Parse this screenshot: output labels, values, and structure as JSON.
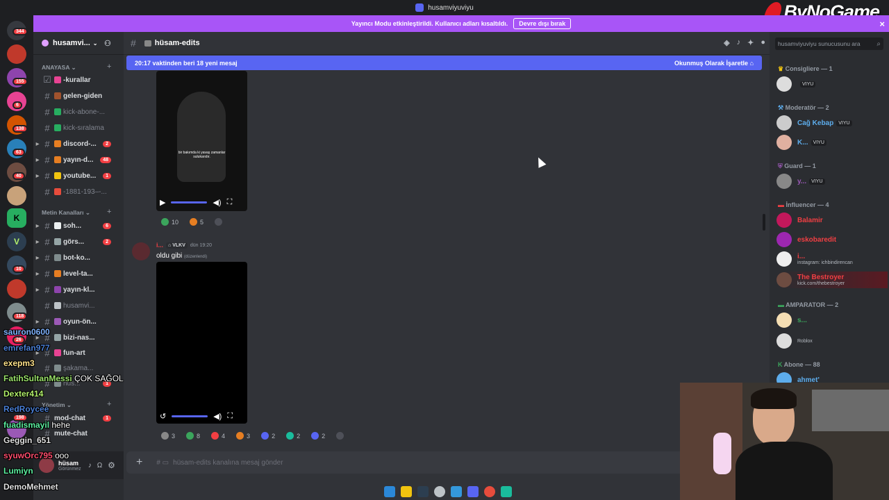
{
  "window": {
    "title": "husamviyuviyu"
  },
  "brand": {
    "text": "ByNoGame"
  },
  "banner": {
    "text": "Yayıncı Modu etkinleştirildi. Kullanıcı adları kısaltıldı.",
    "button": "Devre dışı bırak"
  },
  "guild_badges": [
    "344",
    "155",
    "6",
    "138",
    "63",
    "40",
    "10",
    "118",
    "26",
    "198"
  ],
  "server": {
    "name": "husamvi...",
    "chevron": "v"
  },
  "categories": {
    "anayasa": "ANAYASA",
    "metin": "Metin Kanalları",
    "yonetim": "Yönetim"
  },
  "channels": [
    {
      "name": "-kurallar",
      "badge": ""
    },
    {
      "name": "gelen-giden",
      "badge": ""
    },
    {
      "name": "kick-abone-...",
      "badge": ""
    },
    {
      "name": "kick-sıralama",
      "badge": ""
    },
    {
      "name": "discord-...",
      "badge": "2"
    },
    {
      "name": "yayın-d...",
      "badge": "48"
    },
    {
      "name": "youtube...",
      "badge": "1"
    },
    {
      "name": "-1881-193‒-...",
      "badge": ""
    },
    {
      "name": "soh...",
      "badge": "6"
    },
    {
      "name": "görs...",
      "badge": "2"
    },
    {
      "name": "bot-ko...",
      "badge": ""
    },
    {
      "name": "level-ta...",
      "badge": ""
    },
    {
      "name": "yayın-kl...",
      "badge": ""
    },
    {
      "name": "husamvi...",
      "badge": ""
    },
    {
      "name": "oyun-ön...",
      "badge": ""
    },
    {
      "name": "bizi-nas...",
      "badge": ""
    },
    {
      "name": "fun-art",
      "badge": ""
    },
    {
      "name": "şakama...",
      "badge": ""
    },
    {
      "name": "hüs...",
      "badge": "1"
    },
    {
      "name": "mod-chat",
      "badge": "1"
    },
    {
      "name": "mute-chat",
      "badge": ""
    }
  ],
  "user": {
    "name": "hüsam",
    "status": "Görünmez"
  },
  "chat": {
    "channel": "hüsam-edits",
    "new_messages": "20:17 vaktinden beri 18 yeni mesaj",
    "mark_read": "Okunmuş Olarak İşaretle",
    "video_caption": "bir bakımda ki yavaş zamanlar sulukarıdır.",
    "reactions1": [
      {
        "count": "10",
        "color": "#3ba55c"
      },
      {
        "count": "5",
        "color": "#e67e22"
      }
    ],
    "message": {
      "author": "i...",
      "tag": "VLKV",
      "time": "dün 19:20",
      "text": "oldu gibi",
      "edited": "(düzenlendi)"
    },
    "reactions2": [
      {
        "count": "3",
        "color": "#888"
      },
      {
        "count": "8",
        "color": "#3ba55c"
      },
      {
        "count": "4",
        "color": "#f23f43"
      },
      {
        "count": "3",
        "color": "#e67e22"
      },
      {
        "count": "2",
        "color": "#5865f2"
      },
      {
        "count": "2",
        "color": "#1abc9c"
      },
      {
        "count": "2",
        "color": "#5865f2"
      }
    ],
    "input_placeholder": "hüsam-edits kanalına mesaj gönder"
  },
  "members": {
    "search_placeholder": "husamviyuviyu sunucusunu ara",
    "roles": [
      {
        "title": "Consigliere — 1"
      },
      {
        "title": "Moderatör — 2"
      },
      {
        "title": "Guard — 1"
      },
      {
        "title": "İnfluencer — 4"
      },
      {
        "title": "AMPARATOR — 2"
      },
      {
        "title": "Abone — 88"
      }
    ],
    "list": [
      {
        "name": "",
        "tag": "VIYU",
        "color": "#dbdee1",
        "sub": ""
      },
      {
        "name": "Cağ Kebap",
        "tag": "VIYU",
        "color": "#5dadec",
        "sub": ""
      },
      {
        "name": "K...",
        "tag": "VIYU",
        "color": "#5dadec",
        "sub": ""
      },
      {
        "name": "y...",
        "tag": "VIYU",
        "color": "#9b59b6",
        "sub": ""
      },
      {
        "name": "Balamir",
        "tag": "",
        "color": "#f23f43",
        "sub": ""
      },
      {
        "name": "eskobaredit",
        "tag": "",
        "color": "#f23f43",
        "sub": ""
      },
      {
        "name": "i...",
        "tag": "",
        "color": "#f23f43",
        "sub": "instagram: ichbindirencan"
      },
      {
        "name": "The Bestroyer",
        "tag": "",
        "color": "#f23f43",
        "sub": "kick.com/thebestroyer"
      },
      {
        "name": "s...",
        "tag": "",
        "color": "#3ba55c",
        "sub": ""
      },
      {
        "name": "",
        "tag": "",
        "color": "#3ba55c",
        "sub": "Roblox"
      },
      {
        "name": "ahmet'",
        "tag": "",
        "color": "#5dadec",
        "sub": ""
      }
    ]
  },
  "overlay_chat": [
    {
      "user": "sauron0600",
      "color": "#7fb3ff",
      "msg": ""
    },
    {
      "user": "emrefan977",
      "color": "#4a7fd6",
      "msg": ""
    },
    {
      "user": "exepm3",
      "color": "#ffe28a",
      "msg": ""
    },
    {
      "user": "FatihSultanMessi",
      "color": "#9be36b",
      "msg": "ÇOK SAĞOL"
    },
    {
      "user": "Dexter414",
      "color": "#b2f06b",
      "msg": ""
    },
    {
      "user": "RedRoycee",
      "color": "#4a7fd6",
      "msg": ""
    },
    {
      "user": "fuadismayil",
      "color": "#5cf0a0",
      "msg": "hehe"
    },
    {
      "user": "Geggin_651",
      "color": "#e0e0e0",
      "msg": ""
    },
    {
      "user": "syuwOrc795",
      "color": "#ff4d6d",
      "msg": "ooo"
    },
    {
      "user": "Lumiyn",
      "color": "#5cf0a0",
      "msg": ""
    },
    {
      "user": "DemoMehmet",
      "color": "#e0e0e0",
      "msg": ""
    }
  ],
  "icons": [
    "hash-icon",
    "bell-icon",
    "pin-icon",
    "members-icon",
    "search-icon",
    "plus-icon",
    "play-icon",
    "volume-icon",
    "fullscreen-icon"
  ]
}
